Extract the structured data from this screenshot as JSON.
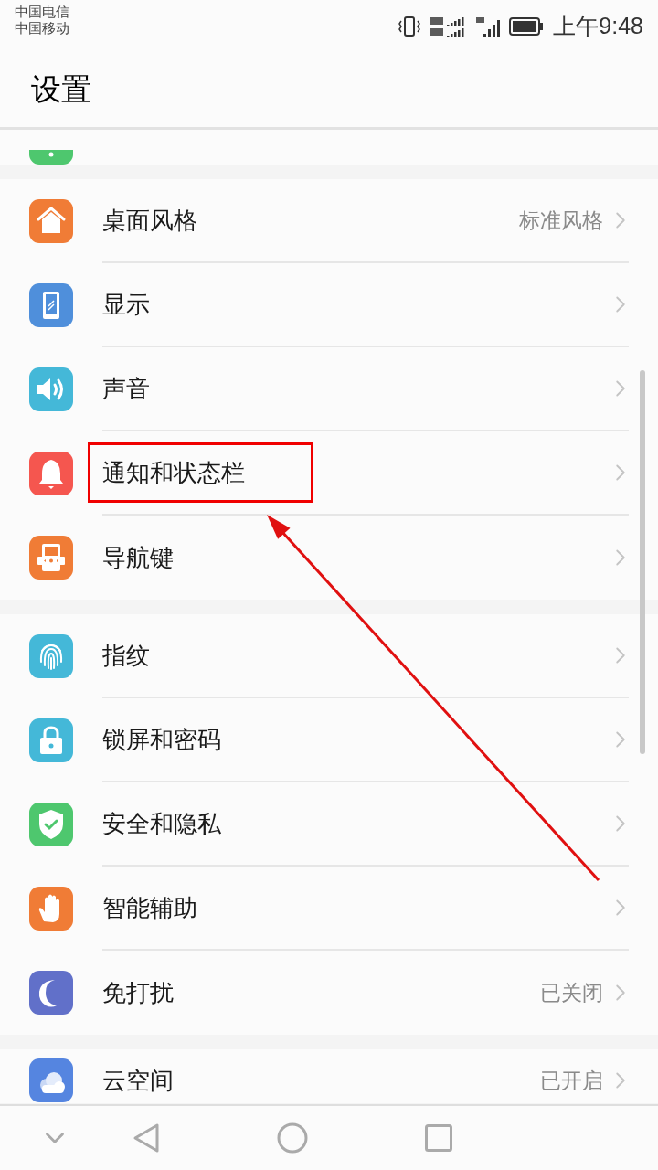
{
  "status_bar": {
    "carriers": [
      "中国电信",
      "中国移动"
    ],
    "time": "上午9:48"
  },
  "title": "设置",
  "groups": [
    {
      "items": [
        {
          "label": "桌面风格",
          "value": "标准风格",
          "kind": "home",
          "color": "#f07c36",
          "highlighted": false
        },
        {
          "label": "显示",
          "kind": "display",
          "color": "#4f8fdb",
          "highlighted": false
        },
        {
          "label": "声音",
          "kind": "sound",
          "color": "#44b8d8",
          "highlighted": false
        },
        {
          "label": "通知和状态栏",
          "kind": "bell",
          "color": "#f5564f",
          "highlighted": true
        },
        {
          "label": "导航键",
          "kind": "nav",
          "color": "#f07c36",
          "highlighted": false
        }
      ]
    },
    {
      "items": [
        {
          "label": "指纹",
          "kind": "fingerprint",
          "color": "#44b8d8",
          "highlighted": false
        },
        {
          "label": "锁屏和密码",
          "kind": "lock",
          "color": "#44b8d8",
          "highlighted": false
        },
        {
          "label": "安全和隐私",
          "kind": "shield",
          "color": "#4ec76e",
          "highlighted": false
        },
        {
          "label": "智能辅助",
          "kind": "hand",
          "color": "#f07c36",
          "highlighted": false
        },
        {
          "label": "免打扰",
          "value": "已关闭",
          "kind": "moon",
          "color": "#6170c9",
          "highlighted": false
        }
      ]
    },
    {
      "items": [
        {
          "label": "云空间",
          "value": "已开启",
          "kind": "cloud",
          "color": "#5585e0",
          "highlighted": false
        }
      ]
    }
  ]
}
